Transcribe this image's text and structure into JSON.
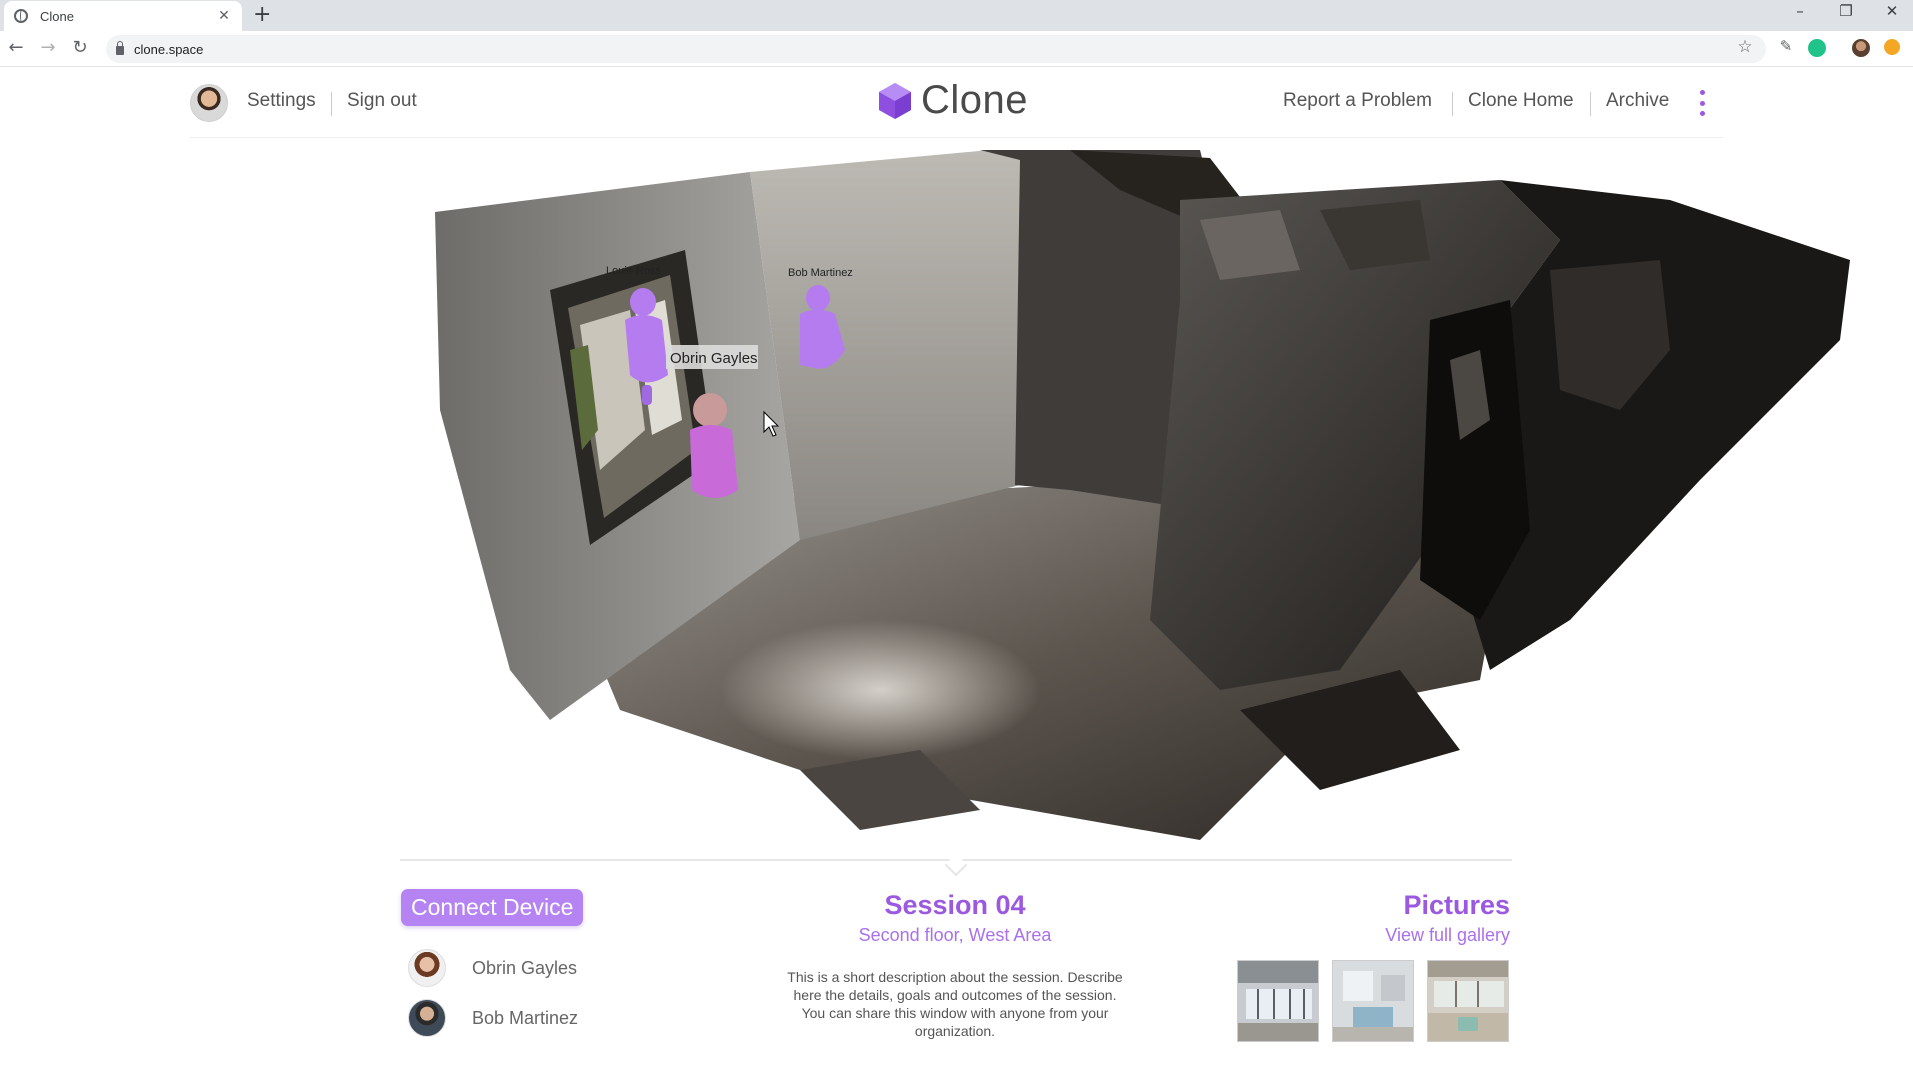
{
  "browser": {
    "tab_title": "Clone",
    "tab_close": "✕",
    "new_tab": "+",
    "url": "clone.space",
    "win_minimize": "–",
    "win_restore": "❐",
    "win_close": "✕"
  },
  "header": {
    "settings": "Settings",
    "sign_out": "Sign out",
    "logo": "Clone",
    "report": "Report a Problem",
    "home": "Clone Home",
    "archive": "Archive"
  },
  "viewport": {
    "labels": [
      "Louie Ross",
      "Bob Martinez",
      "Obrin Gayles"
    ],
    "avatar_color": "#b57cf0"
  },
  "panel": {
    "connect": "Connect Device",
    "people": [
      {
        "name": "Obrin Gayles"
      },
      {
        "name": "Bob Martinez"
      }
    ],
    "session_title": "Session 04",
    "session_sub": "Second floor, West Area",
    "session_desc": "This is a short description about the session. Describe here the details, goals and outcomes of the session. You can share this window with anyone from your organization.",
    "pictures": "Pictures",
    "gallery": "View full gallery"
  },
  "colors": {
    "accent": "#9b59e0",
    "button": "#b584f2"
  }
}
